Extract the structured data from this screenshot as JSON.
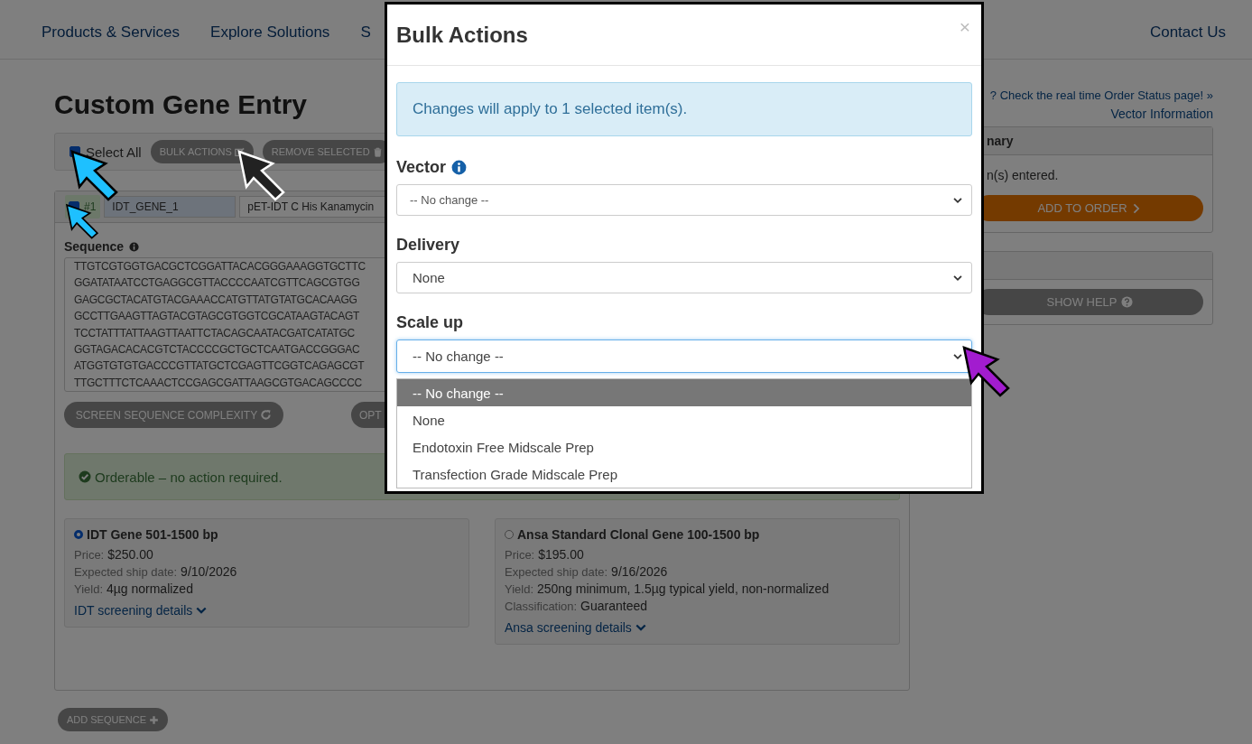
{
  "nav": {
    "items": [
      "Products & Services",
      "Explore Solutions",
      "S"
    ],
    "contact": "Contact Us"
  },
  "page": {
    "title": "Custom Gene Entry",
    "order_status_link": "? Check the real time Order Status page! »",
    "vector_info_link": "Vector Information"
  },
  "toolbar": {
    "select_all": {
      "label": "Select All",
      "checked": true
    },
    "buttons": [
      {
        "label": "BULK ACTIONS",
        "kind": "edit"
      },
      {
        "label": "REMOVE SELECTED",
        "kind": "trash"
      }
    ]
  },
  "sequence": {
    "checked": true,
    "number": "#1",
    "name": "IDT_GENE_1",
    "vector": "pET-IDT C His Kanamycin",
    "label": "Sequence",
    "lines": [
      "TTGTCGTGGTGACGCTCGGATTACACGGGAAAGGTGCTTC",
      "GGATATAATCCTGAGGCGTTACCCCAATCGTTCAGCGTGG",
      "GAGCGCTACATGTACGAAACCATGTTATGTATGCACAAGG",
      "GCCTTGAAGTTAGTACGTAGCGTGGTCGCATAAGTACAGT",
      "TCCTATTTATTAAGTTAATTCTACAGCAATACGATCATATGC",
      "GGTAGACACACGTCTACCCCGCTGCTCAATGACCGGGAC",
      "ATGGTGTGTGACCCGTTATGCTCGAGTTCGGTCAGAGCGT",
      "TTGCTTTCTCAAACTCCGAGCGATTAAGCGTGACAGCCCC"
    ],
    "buttons": [
      {
        "label": "SCREEN SEQUENCE COMPLEXITY",
        "kind": "refresh"
      },
      {
        "label": "OPT",
        "kind": "plain"
      }
    ],
    "status": "Orderable – no action required.",
    "options": [
      {
        "title": "IDT Gene 501-1500 bp",
        "selected": true,
        "details": [
          {
            "label": "Price:",
            "value": "$250.00"
          },
          {
            "label": "Expected ship date:",
            "value": "9/10/2026"
          },
          {
            "label": "Yield:",
            "value": "4µg normalized"
          }
        ],
        "link": "IDT screening details"
      },
      {
        "title": "Ansa Standard Clonal Gene 100-1500 bp",
        "selected": false,
        "details": [
          {
            "label": "Price:",
            "value": "$195.00"
          },
          {
            "label": "Expected ship date:",
            "value": "9/16/2026"
          },
          {
            "label": "Yield:",
            "value": "250ng minimum, 1.5µg typical yield, non-normalized"
          },
          {
            "label": "Classification:",
            "value": "Guaranteed"
          }
        ],
        "link": "Ansa screening details"
      }
    ]
  },
  "add_sequence": "ADD SEQUENCE",
  "summary": {
    "header": "nary",
    "text": "n(s) entered.",
    "button": "ADD TO ORDER"
  },
  "help": {
    "button": "SHOW HELP"
  },
  "modal": {
    "title": "Bulk Actions",
    "close": "×",
    "alert": "Changes will apply to 1 selected item(s).",
    "fields": [
      {
        "label": "Vector",
        "info": true,
        "value": "-- No change --",
        "focused": false,
        "kind": "small"
      },
      {
        "label": "Delivery",
        "info": false,
        "value": "None",
        "focused": false,
        "kind": "normal"
      },
      {
        "label": "Scale up",
        "info": false,
        "value": "-- No change --",
        "focused": true,
        "kind": "normal",
        "options": [
          {
            "label": "-- No change --",
            "selected": true
          },
          {
            "label": "None",
            "selected": false
          },
          {
            "label": "Endotoxin Free Midscale Prep",
            "selected": false
          },
          {
            "label": "Transfection Grade Midscale Prep",
            "selected": false
          }
        ]
      }
    ]
  }
}
